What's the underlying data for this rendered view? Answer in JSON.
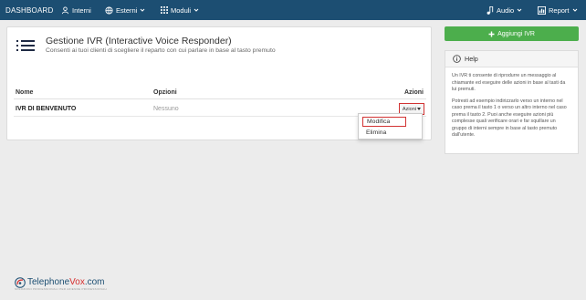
{
  "navbar": {
    "brand": "DASHBOARD",
    "interni": "Interni",
    "esterni": "Esterni",
    "moduli": "Moduli",
    "audio": "Audio",
    "report": "Report"
  },
  "panel": {
    "title": "Gestione IVR (Interactive Voice Responder)",
    "subtitle": "Consenti ai tuoi clienti di scegliere il reparto con cui parlare in base al tasto premuto",
    "columns": {
      "name": "Nome",
      "options": "Opzioni",
      "actions": "Azioni"
    },
    "rows": [
      {
        "name": "IVR DI BENVENUTO",
        "options": "Nessuno",
        "action_button": "Azioni"
      }
    ]
  },
  "dropdown": {
    "items": [
      "Modifica",
      "Elimina"
    ]
  },
  "add_button": "Aggiungi IVR",
  "help": {
    "title": "Help",
    "paragraphs": [
      "Un IVR ti consente di riprodurre un messaggio al chiamante ed eseguire delle azioni in base al tasti da lui premuti.",
      "Potresti ad esempio indirizzarlo verso un interno nel caso prema il tasto 1 o verso un altro interno nel caso prema il tasto 2. Puoi anche eseguire azioni più complesse quali verificare orari e far squillare un gruppo di interni sempre in base al tasto premuto dall'utente."
    ]
  },
  "footer": {
    "logo_main": "Telephone",
    "logo_accent": "Vox",
    "logo_suffix": ".com",
    "logo_tagline": "SOLUZIONI PROFESSIONALI PER AZIENDE PROFESSIONALI"
  },
  "colors": {
    "navbar": "#1c4e72",
    "success": "#4cae4c",
    "highlight": "#d23333"
  }
}
